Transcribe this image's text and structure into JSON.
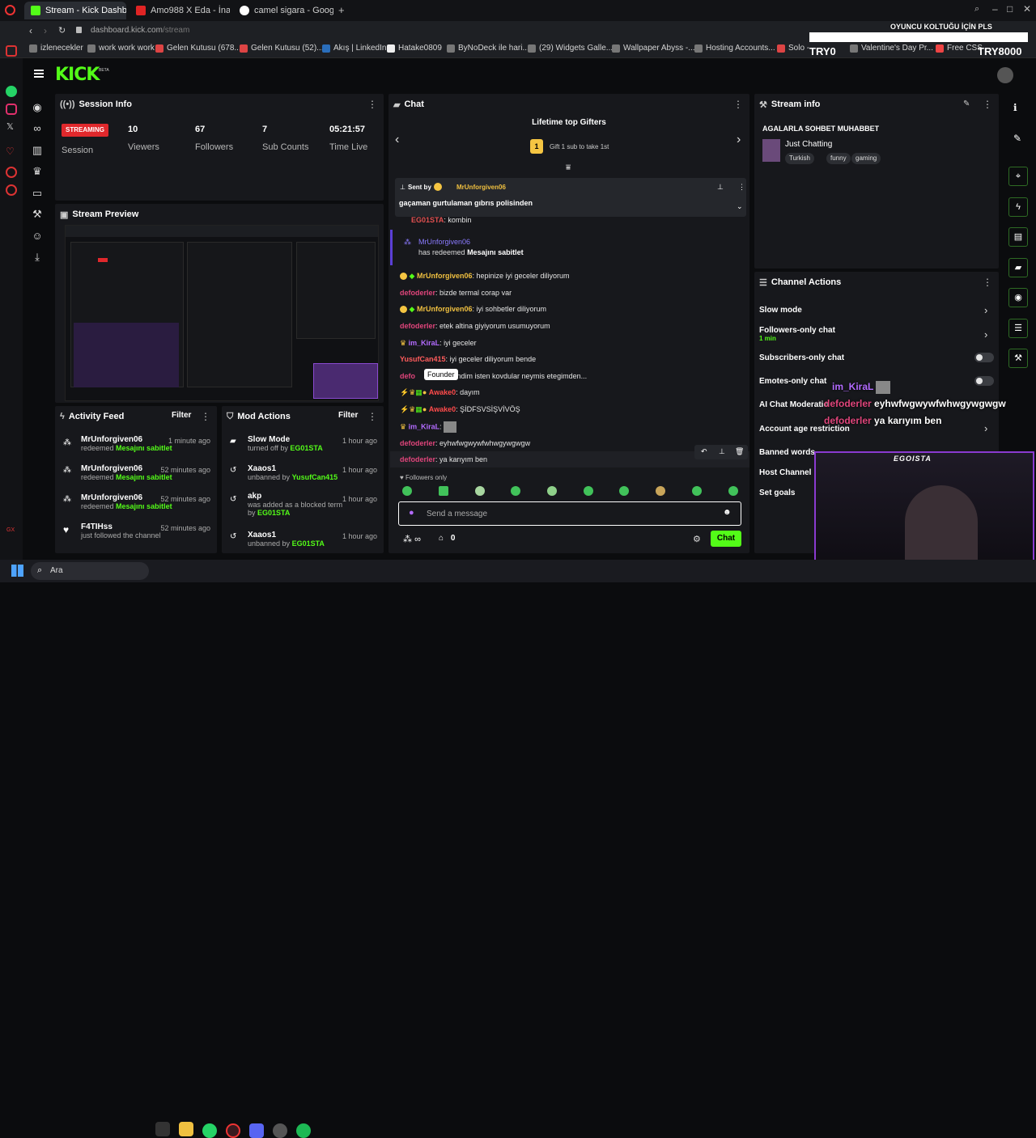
{
  "browser": {
    "tabs": [
      {
        "label": "Stream - Kick Dashboard",
        "color": "#53fc18"
      },
      {
        "label": "Amo988 X Eda - İnanırım",
        "color": "#e02424"
      },
      {
        "label": "camel sigara - Google'da",
        "color": "#ffffff"
      }
    ],
    "url_host": "dashboard.kick.com",
    "url_path": "/stream",
    "bookmarks": [
      "izlenecekler",
      "work work work",
      "Gelen Kutusu (678...",
      "Gelen Kutusu (52)...",
      "Akış | LinkedIn",
      "Hatake0809",
      "ByNoDeck ile hari...",
      "(29) Widgets Galle...",
      "Wallpaper Abyss -...",
      "Hosting Accounts...",
      "Solo -",
      "Valentine's Day Pr...",
      "Free CSS"
    ]
  },
  "overlay": {
    "top_text": "OYUNCU KOLTUĞU İÇİN PLS",
    "left_tag": "TRY0",
    "right_tag": "TRY8000",
    "cam_name": "EGOISTA"
  },
  "brand": {
    "logo": "KICK",
    "beta": "BETA",
    "accent": "#53fc18"
  },
  "session": {
    "title": "Session Info",
    "status": "STREAMING",
    "session_label": "Session",
    "stats": [
      {
        "value": "10",
        "label": "Viewers"
      },
      {
        "value": "67",
        "label": "Followers"
      },
      {
        "value": "7",
        "label": "Sub Counts"
      },
      {
        "value": "05:21:57",
        "label": "Time Live"
      }
    ]
  },
  "preview": {
    "title": "Stream Preview"
  },
  "activity": {
    "title": "Activity Feed",
    "filter": "Filter",
    "items": [
      {
        "user": "MrUnforgiven06",
        "action": "redeemed",
        "reward": "Mesajını sabitlet",
        "time": "1 minute ago"
      },
      {
        "user": "MrUnforgiven06",
        "action": "redeemed",
        "reward": "Mesajını sabitlet",
        "time": "52 minutes ago"
      },
      {
        "user": "MrUnforgiven06",
        "action": "redeemed",
        "reward": "Mesajını sabitlet",
        "time": "52 minutes ago"
      },
      {
        "user": "F4TIHss",
        "action": "just followed the channel",
        "reward": "",
        "time": "52 minutes ago"
      }
    ]
  },
  "mod": {
    "title": "Mod Actions",
    "filter": "Filter",
    "items": [
      {
        "title": "Slow Mode",
        "desc": "turned off by",
        "by": "EG01STA",
        "time": "1 hour ago"
      },
      {
        "title": "Xaaos1",
        "desc": "unbanned by",
        "by": "YusufCan415",
        "time": "1 hour ago"
      },
      {
        "title": "akp",
        "desc": "was added as a blocked term by",
        "by": "EG01STA",
        "time": "1 hour ago"
      },
      {
        "title": "Xaaos1",
        "desc": "unbanned by",
        "by": "EG01STA",
        "time": "1 hour ago"
      }
    ]
  },
  "chat": {
    "title": "Chat",
    "gifters_title": "Lifetime top Gifters",
    "gifters_badge": "1",
    "gifters_sub": "Gift 1 sub to take 1st",
    "pinned_by_label": "Sent by",
    "pinned_by": "MrUnforgiven06",
    "pinned_text": "gaçaman gurtulaman gıbrıs polisinden",
    "partial_user": "EG01STA",
    "partial_text": "kombin",
    "redeem_user": "MrUnforgiven06",
    "redeem_text": "has redeemed",
    "redeem_reward": "Mesajını sabitlet",
    "messages": [
      {
        "user": "MrUnforgiven06",
        "color": "#f0c040",
        "text": "hepinize iyi geceler diliyorum"
      },
      {
        "user": "defoderler",
        "color": "#e0457b",
        "text": "bizde termal corap var"
      },
      {
        "user": "MrUnforgiven06",
        "color": "#f0c040",
        "text": "iyi sohbetler diliyorum"
      },
      {
        "user": "defoderler",
        "color": "#e0457b",
        "text": "etek altina giyiyorum usumuyorum"
      },
      {
        "user": "im_KiraL",
        "color": "#b36bff",
        "text": "iyi geceler"
      },
      {
        "user": "YusufCan415",
        "color": "#ff5c5c",
        "text": "iyi geceler diliyorum bende"
      },
      {
        "user": "defo",
        "color": "#e0457b",
        "text": "fendim isten kovdular neymis etegimden..."
      },
      {
        "user": "Awake0",
        "color": "#ff4b4b",
        "text": "dayım"
      },
      {
        "user": "Awake0",
        "color": "#ff4b4b",
        "text": "ŞİDFSVSİŞVİVÖŞ"
      },
      {
        "user": "im_KiraL",
        "color": "#b36bff",
        "text": ""
      },
      {
        "user": "defoderler",
        "color": "#e0457b",
        "text": "eyhwfwgwywfwhwgywgwgw"
      },
      {
        "user": "defoderler",
        "color": "#e0457b",
        "text": "ya karıyım ben"
      }
    ],
    "tooltip": "Founder",
    "followers_only": "Followers only",
    "input_placeholder": "Send a message",
    "points": "∞",
    "gifts": "0",
    "send_label": "Chat"
  },
  "stream_info": {
    "title": "Stream info",
    "stream_title": "AGALARLA SOHBET MUHABBET",
    "category": "Just Chatting",
    "tags": [
      "Turkish",
      "funny",
      "gaming"
    ]
  },
  "channel_actions": {
    "title": "Channel Actions",
    "items": [
      {
        "label": "Slow mode",
        "sub": ""
      },
      {
        "label": "Followers-only chat",
        "sub": "1 min"
      },
      {
        "label": "Subscribers-only chat",
        "sub": ""
      },
      {
        "label": "Emotes-only chat",
        "sub": ""
      },
      {
        "label": "AI Chat Moderatio",
        "sub": ""
      },
      {
        "label": "Account age restriction",
        "sub": ""
      },
      {
        "label": "Banned words",
        "sub": ""
      },
      {
        "label": "Host Channel",
        "sub": ""
      },
      {
        "label": "Set goals",
        "sub": ""
      }
    ]
  },
  "overlay_chat": [
    {
      "user": "im_KiraL",
      "text": ""
    },
    {
      "user": "defoderler",
      "text": "eyhwfwgwywfwhwgywgwgw"
    },
    {
      "user": "defoderler",
      "text": "ya karıyım ben"
    }
  ],
  "taskbar": {
    "search_label": "Ara"
  }
}
